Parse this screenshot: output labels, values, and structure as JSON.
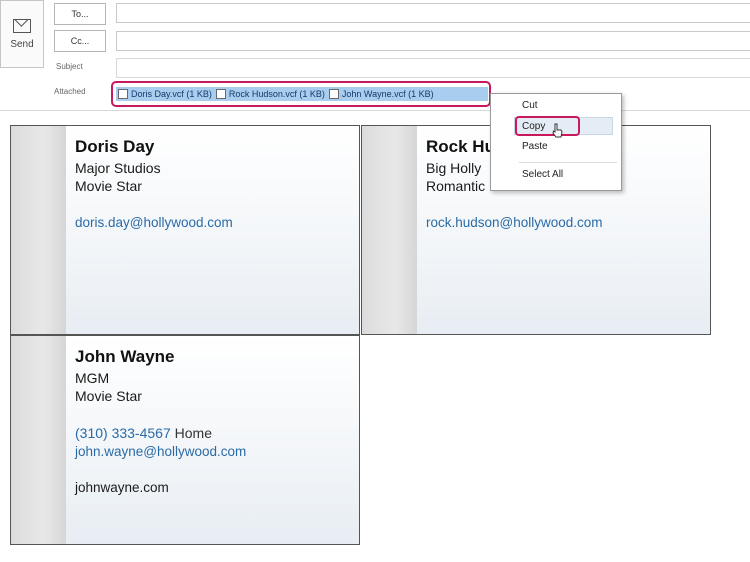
{
  "compose": {
    "send_label": "Send",
    "to_button": "To...",
    "cc_button": "Cc...",
    "to_value": "",
    "cc_value": "",
    "subject_label": "Subject",
    "subject_value": "",
    "attached_label": "Attached",
    "attachments": [
      "Doris Day.vcf (1 KB)",
      "Rock Hudson.vcf (1 KB)",
      "John Wayne.vcf (1 KB)"
    ]
  },
  "context_menu": {
    "items": [
      "Cut",
      "Copy",
      "Paste",
      "Select All"
    ],
    "highlighted": "Copy",
    "highlight_color": "#c8195c"
  },
  "cards": [
    {
      "name": "Doris Day",
      "company": "Major Studios",
      "title": "Movie Star",
      "email": "doris.day@hollywood.com"
    },
    {
      "name": "Rock Hu",
      "company": "Big Holly",
      "title": "Romantic",
      "email": "rock.hudson@hollywood.com"
    },
    {
      "name": "John Wayne",
      "company": "MGM",
      "title": "Movie Star",
      "phone": "(310) 333-4567",
      "phone_type": "Home",
      "email": "john.wayne@hollywood.com",
      "website": "johnwayne.com"
    }
  ]
}
